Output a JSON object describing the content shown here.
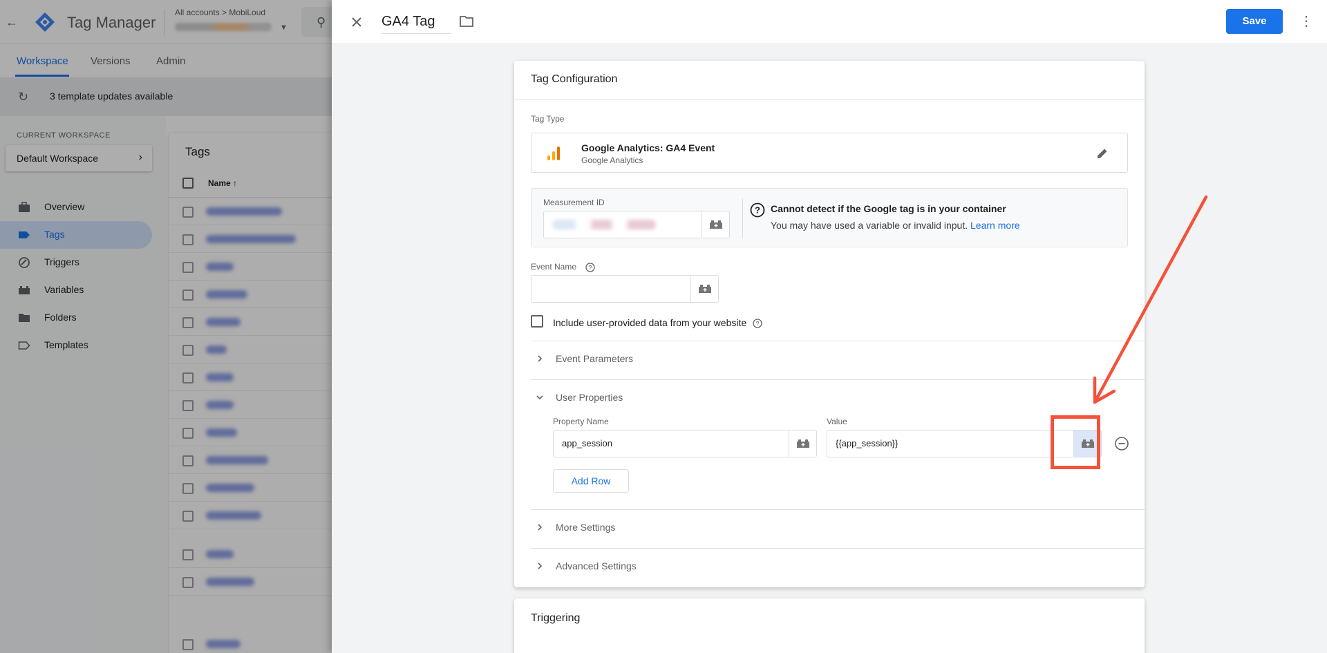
{
  "background_app": {
    "app_name": "Tag Manager",
    "account_path": "All accounts > MobiLoud",
    "tabs": [
      {
        "label": "Workspace"
      },
      {
        "label": "Versions"
      },
      {
        "label": "Admin"
      }
    ],
    "updates_text": "3 template updates available",
    "current_workspace_label": "CURRENT WORKSPACE",
    "workspace_name": "Default Workspace",
    "nav": [
      {
        "label": "Overview",
        "icon": "briefcase-icon"
      },
      {
        "label": "Tags",
        "icon": "tag-icon"
      },
      {
        "label": "Triggers",
        "icon": "trigger-icon"
      },
      {
        "label": "Variables",
        "icon": "variable-icon"
      },
      {
        "label": "Folders",
        "icon": "folder-icon"
      },
      {
        "label": "Templates",
        "icon": "template-icon"
      }
    ],
    "tags_title": "Tags",
    "name_column": "Name ↑"
  },
  "editor": {
    "tag_name": "GA4 Tag",
    "save_label": "Save",
    "card_title": "Tag Configuration",
    "tag_type_label": "Tag Type",
    "tag_type_name": "Google Analytics: GA4 Event",
    "tag_type_sub": "Google Analytics",
    "measurement_id_label": "Measurement ID",
    "warning_title": "Cannot detect if the Google tag is in your container",
    "warning_body": "You may have used a variable or invalid input.",
    "learn_more": "Learn more",
    "event_name_label": "Event Name",
    "event_name_value": "",
    "include_data_label": "Include user-provided data from your website",
    "sections": {
      "event_parameters": "Event Parameters",
      "user_properties": "User Properties",
      "more_settings": "More Settings",
      "advanced_settings": "Advanced Settings"
    },
    "property_name_label": "Property Name",
    "value_label": "Value",
    "property_name_value": "app_session",
    "value_value": "{{app_session}}",
    "add_row_label": "Add Row",
    "triggering_title": "Triggering"
  },
  "colors": {
    "primary": "#1a73e8",
    "annotation": "#f4523b",
    "ga_orange": "#f9ab00",
    "ga_dark": "#e37400"
  }
}
